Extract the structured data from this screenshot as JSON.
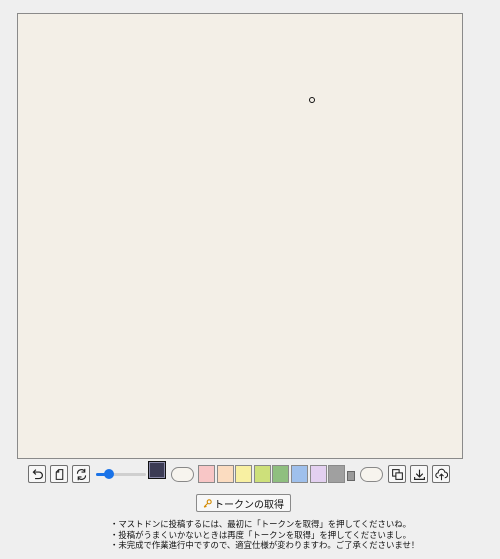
{
  "toolbar": {
    "brush_size_fraction": 0.25,
    "current_color": "#3b3b54",
    "palette": [
      "#f8c6c6",
      "#fbdcc0",
      "#f8f0a2",
      "#cde07a",
      "#8fbf7f",
      "#9fc0ec",
      "#e3d0f0",
      "#a0a0a0"
    ],
    "icons": [
      "undo-icon",
      "clear-page-icon",
      "refresh-icon",
      "copy-icon",
      "download-icon",
      "upload-cloud-icon",
      "key-icon",
      "trash-icon"
    ]
  },
  "token_button": {
    "label": "トークンの取得"
  },
  "notes": [
    "・マストドンに投稿するには、最初に「トークンを取得」を押してくださいね。",
    "・投稿がうまくいかないときは再度「トークンを取得」を押してくださいまし。",
    "・未完成で作業進行中ですので、適宜仕様が変わりますわ。ご了承くださいませ！"
  ]
}
